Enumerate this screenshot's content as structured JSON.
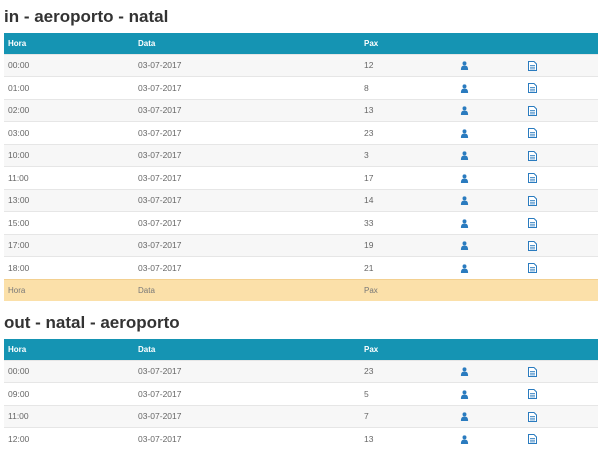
{
  "tables": [
    {
      "title": "in - aeroporto - natal",
      "headers": {
        "hora": "Hora",
        "data": "Data",
        "pax": "Pax"
      },
      "rows": [
        {
          "hora": "00:00",
          "data": "03-07-2017",
          "pax": "12"
        },
        {
          "hora": "01:00",
          "data": "03-07-2017",
          "pax": "8"
        },
        {
          "hora": "02:00",
          "data": "03-07-2017",
          "pax": "13"
        },
        {
          "hora": "03:00",
          "data": "03-07-2017",
          "pax": "23"
        },
        {
          "hora": "10:00",
          "data": "03-07-2017",
          "pax": "3"
        },
        {
          "hora": "11:00",
          "data": "03-07-2017",
          "pax": "17"
        },
        {
          "hora": "13:00",
          "data": "03-07-2017",
          "pax": "14"
        },
        {
          "hora": "15:00",
          "data": "03-07-2017",
          "pax": "33"
        },
        {
          "hora": "17:00",
          "data": "03-07-2017",
          "pax": "19"
        },
        {
          "hora": "18:00",
          "data": "03-07-2017",
          "pax": "21"
        }
      ],
      "footer": {
        "hora": "Hora",
        "data": "Data",
        "pax": "Pax"
      },
      "row_icons": [
        "person-icon",
        "document-icon"
      ]
    },
    {
      "title": "out - natal - aeroporto",
      "headers": {
        "hora": "Hora",
        "data": "Data",
        "pax": "Pax"
      },
      "rows": [
        {
          "hora": "00:00",
          "data": "03-07-2017",
          "pax": "23"
        },
        {
          "hora": "09:00",
          "data": "03-07-2017",
          "pax": "5"
        },
        {
          "hora": "11:00",
          "data": "03-07-2017",
          "pax": "7"
        },
        {
          "hora": "12:00",
          "data": "03-07-2017",
          "pax": "13"
        }
      ],
      "row_icons": [
        "person-icon",
        "document-icon"
      ]
    }
  ],
  "colors": {
    "header_bg": "#1594b3",
    "footer_bg": "#fbe0a9",
    "icon": "#2a7bbf"
  }
}
